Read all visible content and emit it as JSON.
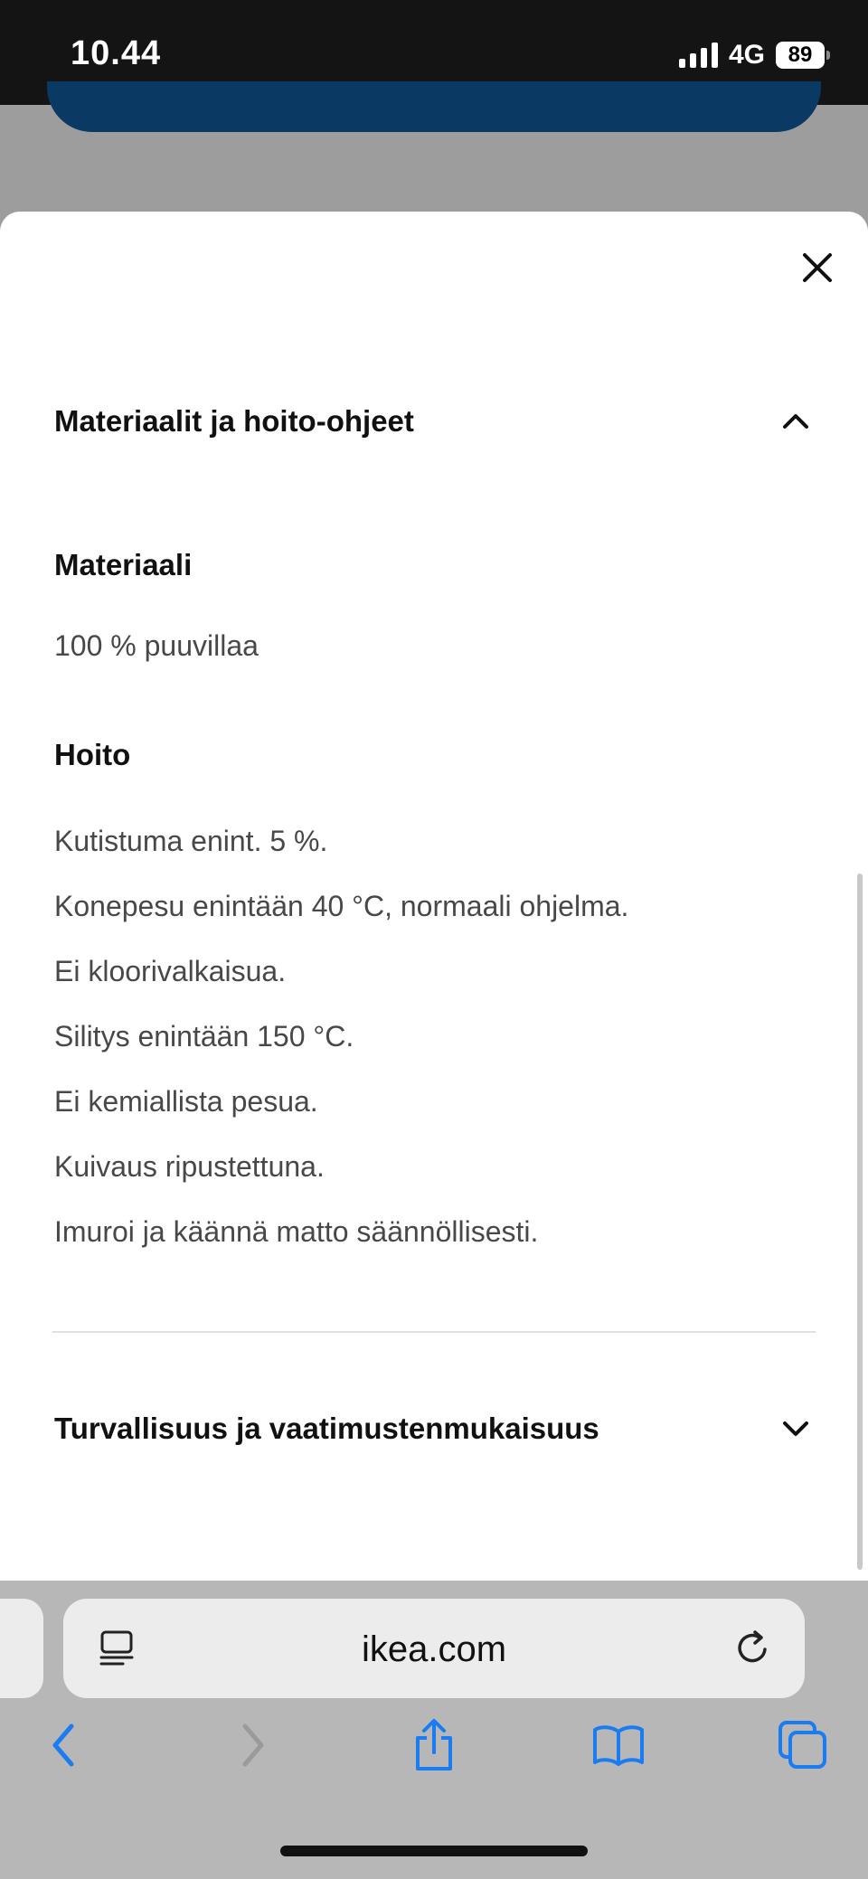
{
  "status_bar": {
    "time": "10.44",
    "network": "4G",
    "battery": "89"
  },
  "sheet": {
    "section_open": {
      "title": "Materiaalit ja hoito-ohjeet"
    },
    "material": {
      "heading": "Materiaali",
      "value": "100 % puuvillaa"
    },
    "care": {
      "heading": "Hoito",
      "items": [
        "Kutistuma enint. 5 %.",
        "Konepesu enintään 40 °C, normaali ohjelma.",
        "Ei kloorivalkaisua.",
        "Silitys enintään 150 °C.",
        "Ei kemiallista pesua.",
        "Kuivaus ripustettuna.",
        "Imuroi ja käännä matto säännöllisesti."
      ]
    },
    "section_collapsed": {
      "title": "Turvallisuus ja vaatimustenmukaisuus"
    }
  },
  "browser": {
    "url": "ikea.com",
    "accent_color": "#1a7cf0"
  }
}
